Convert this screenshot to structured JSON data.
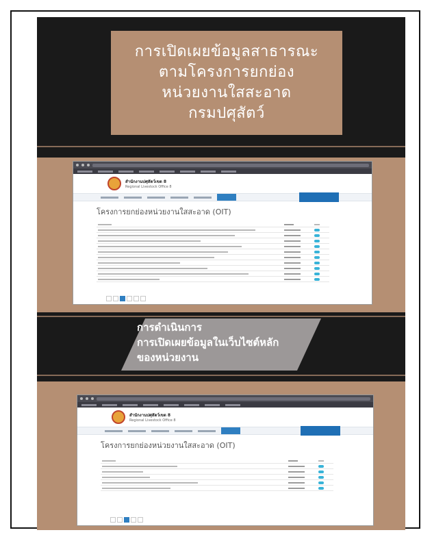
{
  "poster": {
    "title_lines": [
      "การเปิดเผยข้อมูลสาธารณะ",
      "ตามโครงการยกย่อง",
      "หน่วยงานใสสะอาด",
      "กรมปศุสัตว์"
    ],
    "middle_lines": [
      "การดำเนินการ",
      "การเปิดเผยข้อมูลในเว็บไซต์หลัก",
      "ของหน่วยงาน"
    ]
  },
  "screenshot_1": {
    "org_name": "สำนักงานปศุสัตว์เขต 8",
    "org_subtitle": "Regional Livestock Office 8",
    "page_title": "โครงการยกย่องหน่วยงานใสสะอาด (OIT)",
    "row_count": 10
  },
  "screenshot_2": {
    "org_name": "สำนักงานปศุสัตว์เขต 8",
    "org_subtitle": "Regional Livestock Office 8",
    "page_title": "โครงการยกย่องหน่วยงานใสสะอาด (OIT)",
    "row_count": 5
  },
  "colors": {
    "tan": "#b58f73",
    "dark": "#1a1a1a",
    "accent": "#2f7fc1"
  }
}
